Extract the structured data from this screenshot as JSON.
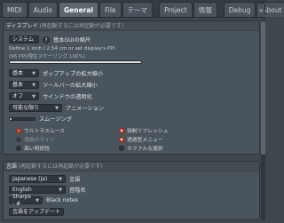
{
  "tabs": [
    {
      "label": "MIDI",
      "active": false
    },
    {
      "label": "Audio",
      "active": false
    },
    {
      "label": "General",
      "active": true
    },
    {
      "label": "File",
      "active": false
    },
    {
      "label": "テーマ",
      "active": false
    },
    {
      "label": "Project",
      "active": false
    },
    {
      "label": "情報",
      "active": false
    },
    {
      "label": "Debug",
      "active": false
    },
    {
      "label": "About",
      "active": false
    }
  ],
  "close_label": "×",
  "display": {
    "header": "ディスプレイ",
    "header_note": "(再起動するには再起動が必要です)",
    "scale_value": "システム",
    "scale_help": "?",
    "scale_label": "基本GUIの縮尺",
    "info_line1": "Define 1 inch / 2.54 cm or set display's PPI",
    "info_line2": "(96 PPI/現在スケーリング 100%)",
    "popup_value": "基本",
    "popup_label": "ポップアップの拡大縮小",
    "toolbar_value": "基本",
    "toolbar_label": "ツールバーの拡大縮小",
    "transparency_value": "オフ",
    "transparency_label": "ウインドウの透明化",
    "animation_value": "可能な限り",
    "animation_label": "アニメーション",
    "smoothing_label": "スムージング",
    "smoothing_level": 0.08,
    "options": [
      {
        "label": "ウルトラスムース",
        "state": "red-off",
        "col": 1
      },
      {
        "label": "強制リフレッシュ",
        "state": "red-on",
        "col": 2
      },
      {
        "label": "透過のライン",
        "state": "dim",
        "col": 1
      },
      {
        "label": "透過型メニュー",
        "state": "red-on",
        "col": 2
      },
      {
        "label": "高い明認性",
        "state": "off",
        "col": 1
      },
      {
        "label": "カラフルな選択",
        "state": "off",
        "col": 2
      }
    ]
  },
  "language": {
    "header": "言語",
    "header_note": "(再起動するには再起動が必要です)",
    "lang_value": "Japanese (ja)",
    "lang_label": "言語",
    "note_lang_value": "English",
    "note_lang_label": "音階名",
    "accidental_value": "Sharps - #",
    "accidental_label": "Black notes",
    "update_button": "言語をアップデート"
  }
}
